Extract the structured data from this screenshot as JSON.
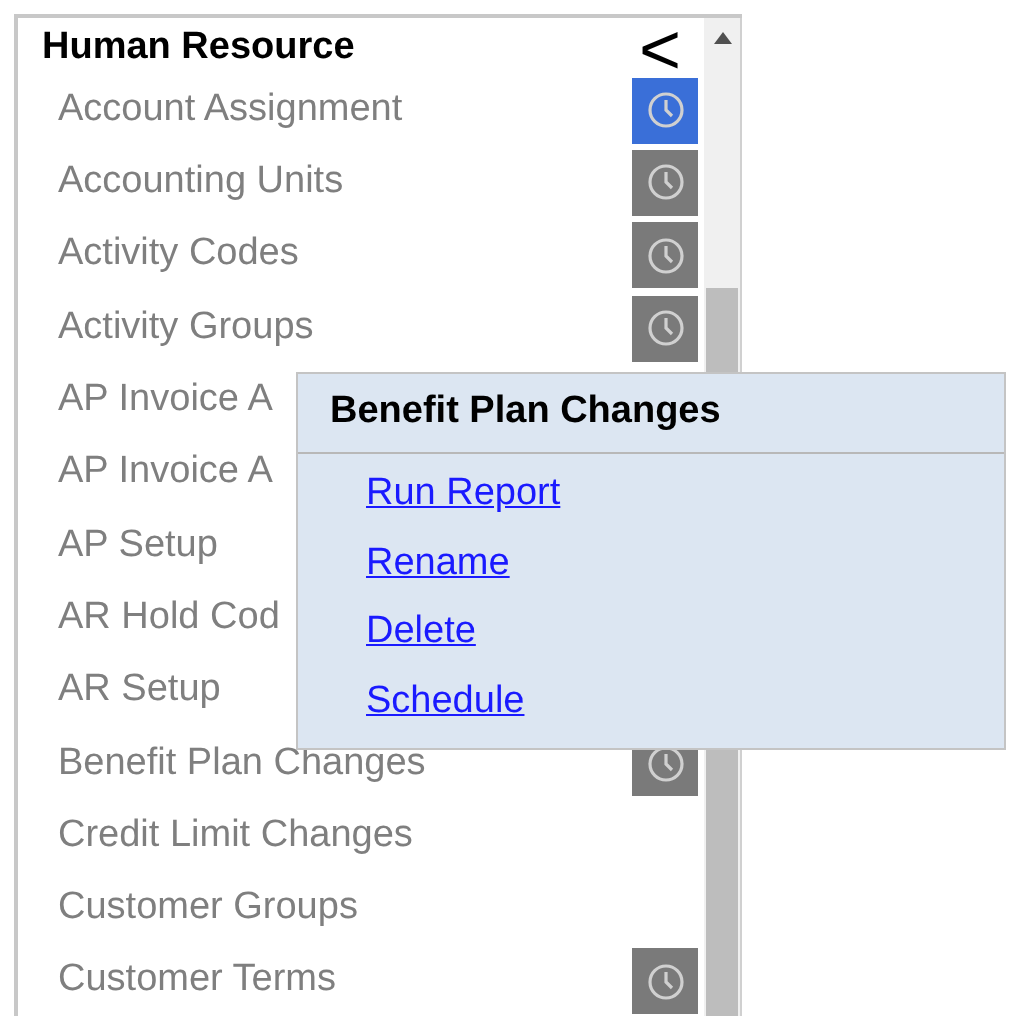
{
  "section": {
    "title": "Human Resource",
    "collapse_glyph": "<"
  },
  "items": [
    {
      "label": "Account Assignment",
      "scheduled": true,
      "selected": true
    },
    {
      "label": "Accounting Units",
      "scheduled": true,
      "selected": false
    },
    {
      "label": "Activity Codes",
      "scheduled": true,
      "selected": false
    },
    {
      "label": "Activity Groups",
      "scheduled": true,
      "selected": false
    },
    {
      "label": "AP Invoice A"
    },
    {
      "label": "AP Invoice A"
    },
    {
      "label": "AP Setup"
    },
    {
      "label": "AR Hold Cod"
    },
    {
      "label": "AR Setup"
    },
    {
      "label": "Benefit Plan Changes",
      "scheduled": true,
      "selected": false
    },
    {
      "label": "Credit Limit Changes",
      "scheduled": false
    },
    {
      "label": "Customer Groups",
      "scheduled": false
    },
    {
      "label": "Customer Terms",
      "scheduled": true,
      "selected": false
    }
  ],
  "context_menu": {
    "title": "Benefit Plan Changes",
    "actions": [
      "Run Report",
      "Rename",
      "Delete",
      "Schedule"
    ]
  }
}
